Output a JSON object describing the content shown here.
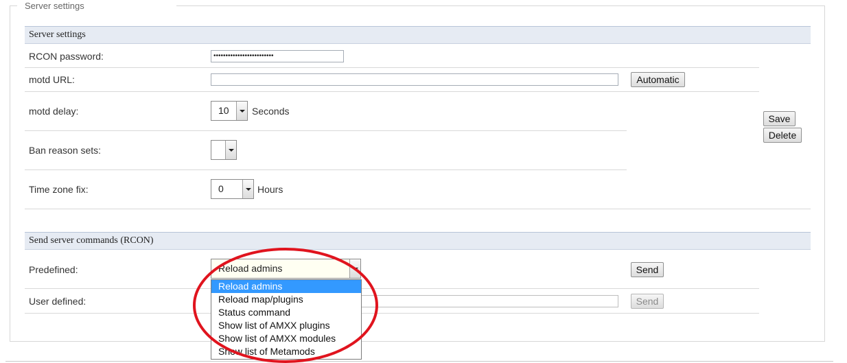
{
  "fieldset": {
    "legend": "Server settings"
  },
  "server_settings": {
    "header": "Server settings",
    "rcon_password": {
      "label": "RCON password:",
      "value": "•••••••••••••••••••••••••"
    },
    "motd_url": {
      "label": "motd URL:",
      "value": "",
      "button": "Automatic"
    },
    "motd_delay": {
      "label": "motd delay:",
      "value": "10",
      "unit": "Seconds"
    },
    "ban_reason_sets": {
      "label": "Ban reason sets:",
      "value": ""
    },
    "time_zone_fix": {
      "label": "Time zone fix:",
      "value": "0",
      "unit": "Hours"
    },
    "save_button": "Save",
    "delete_button": "Delete"
  },
  "rcon": {
    "header": "Send server commands (RCON)",
    "predefined": {
      "label": "Predefined:",
      "selected": "Reload admins",
      "send_button": "Send"
    },
    "user_defined": {
      "label": "User defined:",
      "value": "",
      "send_button": "Send"
    },
    "options": [
      "Reload admins",
      "Reload map/plugins",
      "Status command",
      "Show list of AMXX plugins",
      "Show list of AMXX modules",
      "Show list of Metamods"
    ]
  },
  "annotation": {
    "color": "#e0141e"
  }
}
